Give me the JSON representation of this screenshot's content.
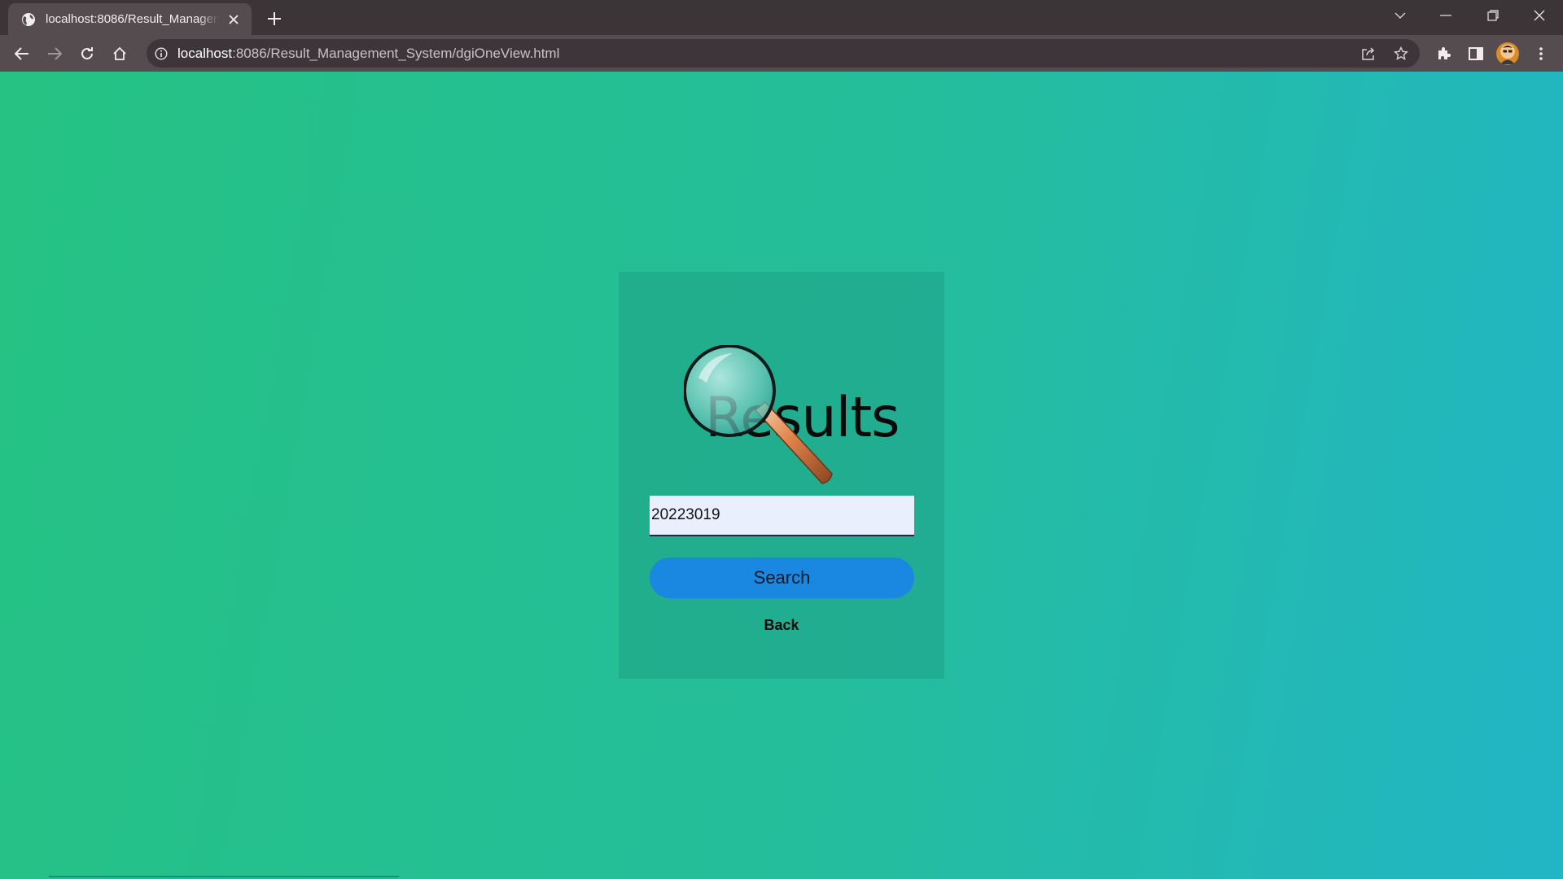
{
  "browser": {
    "tab_title": "localhost:8086/Result_Management_System/dgiOneView.html",
    "url_host": "localhost",
    "url_rest": ":8086/Result_Management_System/dgiOneView.html",
    "icons": {
      "favicon": "globe-icon",
      "tab_close": "close-icon",
      "new_tab": "plus-icon",
      "tab_search": "chevron-down-icon",
      "minimize": "minimize-icon",
      "restore": "restore-icon",
      "close_window": "close-icon",
      "back": "arrow-left-icon",
      "forward": "arrow-right-icon",
      "reload": "reload-icon",
      "home": "home-icon",
      "site_info": "info-icon",
      "share": "share-icon",
      "bookmark": "star-icon",
      "extensions": "puzzle-icon",
      "side_panel": "side-panel-icon",
      "profile": "avatar",
      "menu": "kebab-menu-icon"
    }
  },
  "page": {
    "logo_text": "Results",
    "search": {
      "value": "20223019"
    },
    "search_button_label": "Search",
    "back_link_label": "Back"
  },
  "colors": {
    "gradient_start": "#25c283",
    "gradient_end": "#22b5c6",
    "card": "#1ea08a",
    "button": "#1a87e0",
    "input_bg": "#e9effc"
  }
}
